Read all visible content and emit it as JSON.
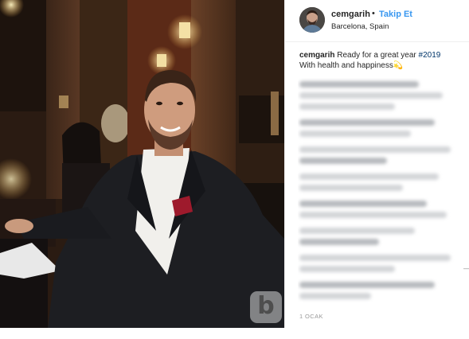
{
  "post": {
    "username": "cemgarih",
    "separator": "•",
    "follow_label": "Takip Et",
    "location": "Barcelona, Spain",
    "caption": {
      "user": "cemgarih",
      "text_before": "Ready for a great year",
      "hashtag": "#2019",
      "line2": "With health and happiness",
      "emoji": "💫"
    },
    "timestamp": "1 OCAK",
    "watermark": "b"
  },
  "colors": {
    "link_blue": "#3897f0",
    "text": "#262626",
    "hashtag": "#003569",
    "muted": "#999999"
  },
  "icons": {
    "follow_dot": "bullet",
    "watermark": "b-logo-watermark"
  }
}
